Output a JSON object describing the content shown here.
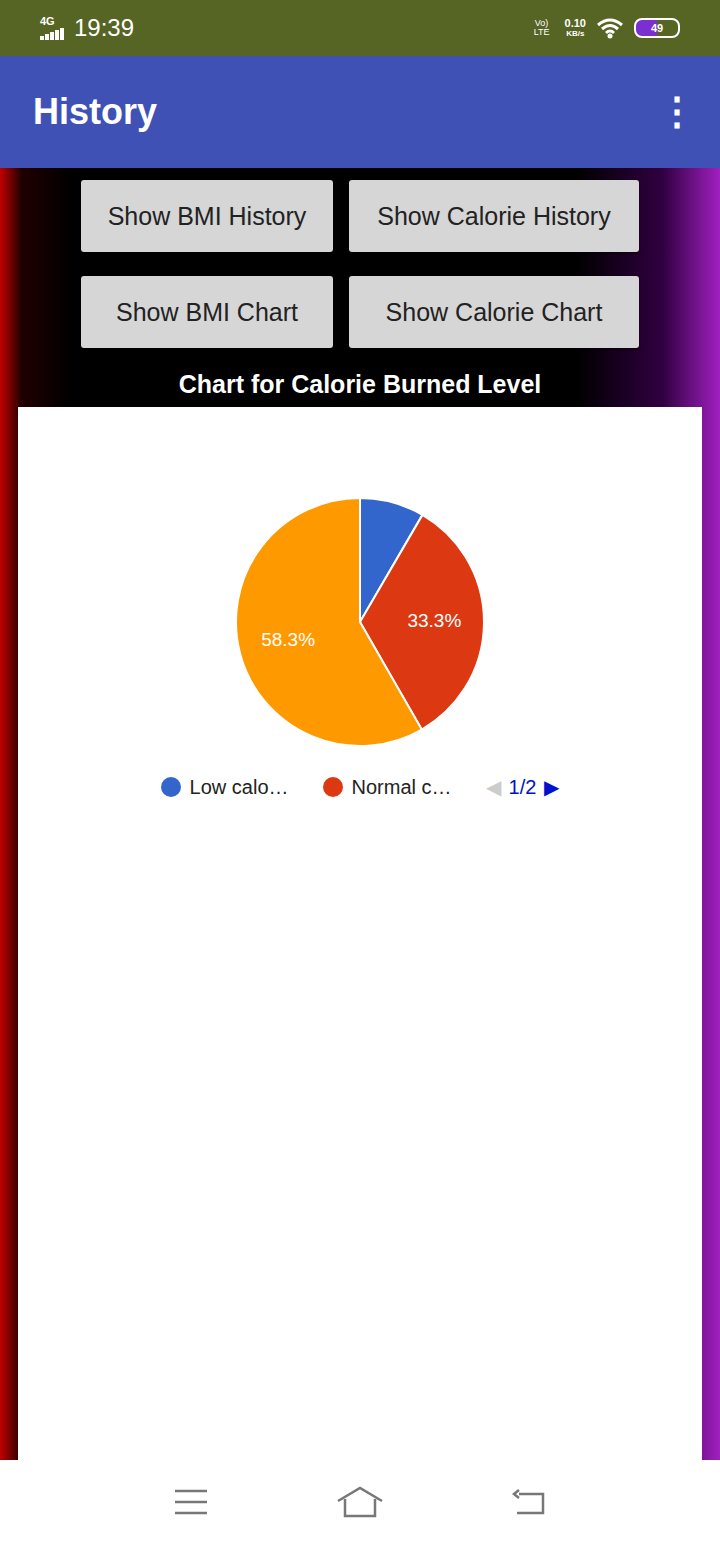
{
  "status_bar": {
    "network": "4G",
    "time": "19:39",
    "volte": "Vo) LTE",
    "speed": "0.10",
    "speed_unit": "KB/s",
    "battery": "49"
  },
  "app_bar": {
    "title": "History",
    "menu": "⋮"
  },
  "buttons": [
    [
      "Show BMI History",
      "Show Calorie History"
    ],
    [
      "Show BMI Chart",
      "Show Calorie Chart"
    ]
  ],
  "chart": {
    "title": "Chart for Calorie Burned Level",
    "slices": [
      {
        "value": 8.4,
        "color": "#3366cc"
      },
      {
        "value": 33.3,
        "label": "33.3%",
        "color": "#dc3912"
      },
      {
        "value": 58.3,
        "label": "58.3%",
        "color": "#ff9900"
      }
    ],
    "legend": {
      "items": [
        {
          "label": "Low calo…",
          "color": "#3366cc"
        },
        {
          "label": "Normal c…",
          "color": "#dc3912"
        }
      ],
      "pager": {
        "prev": "◀",
        "page": "1/2",
        "next": "▶",
        "prev_disabled": true,
        "next_disabled": false
      }
    }
  }
}
